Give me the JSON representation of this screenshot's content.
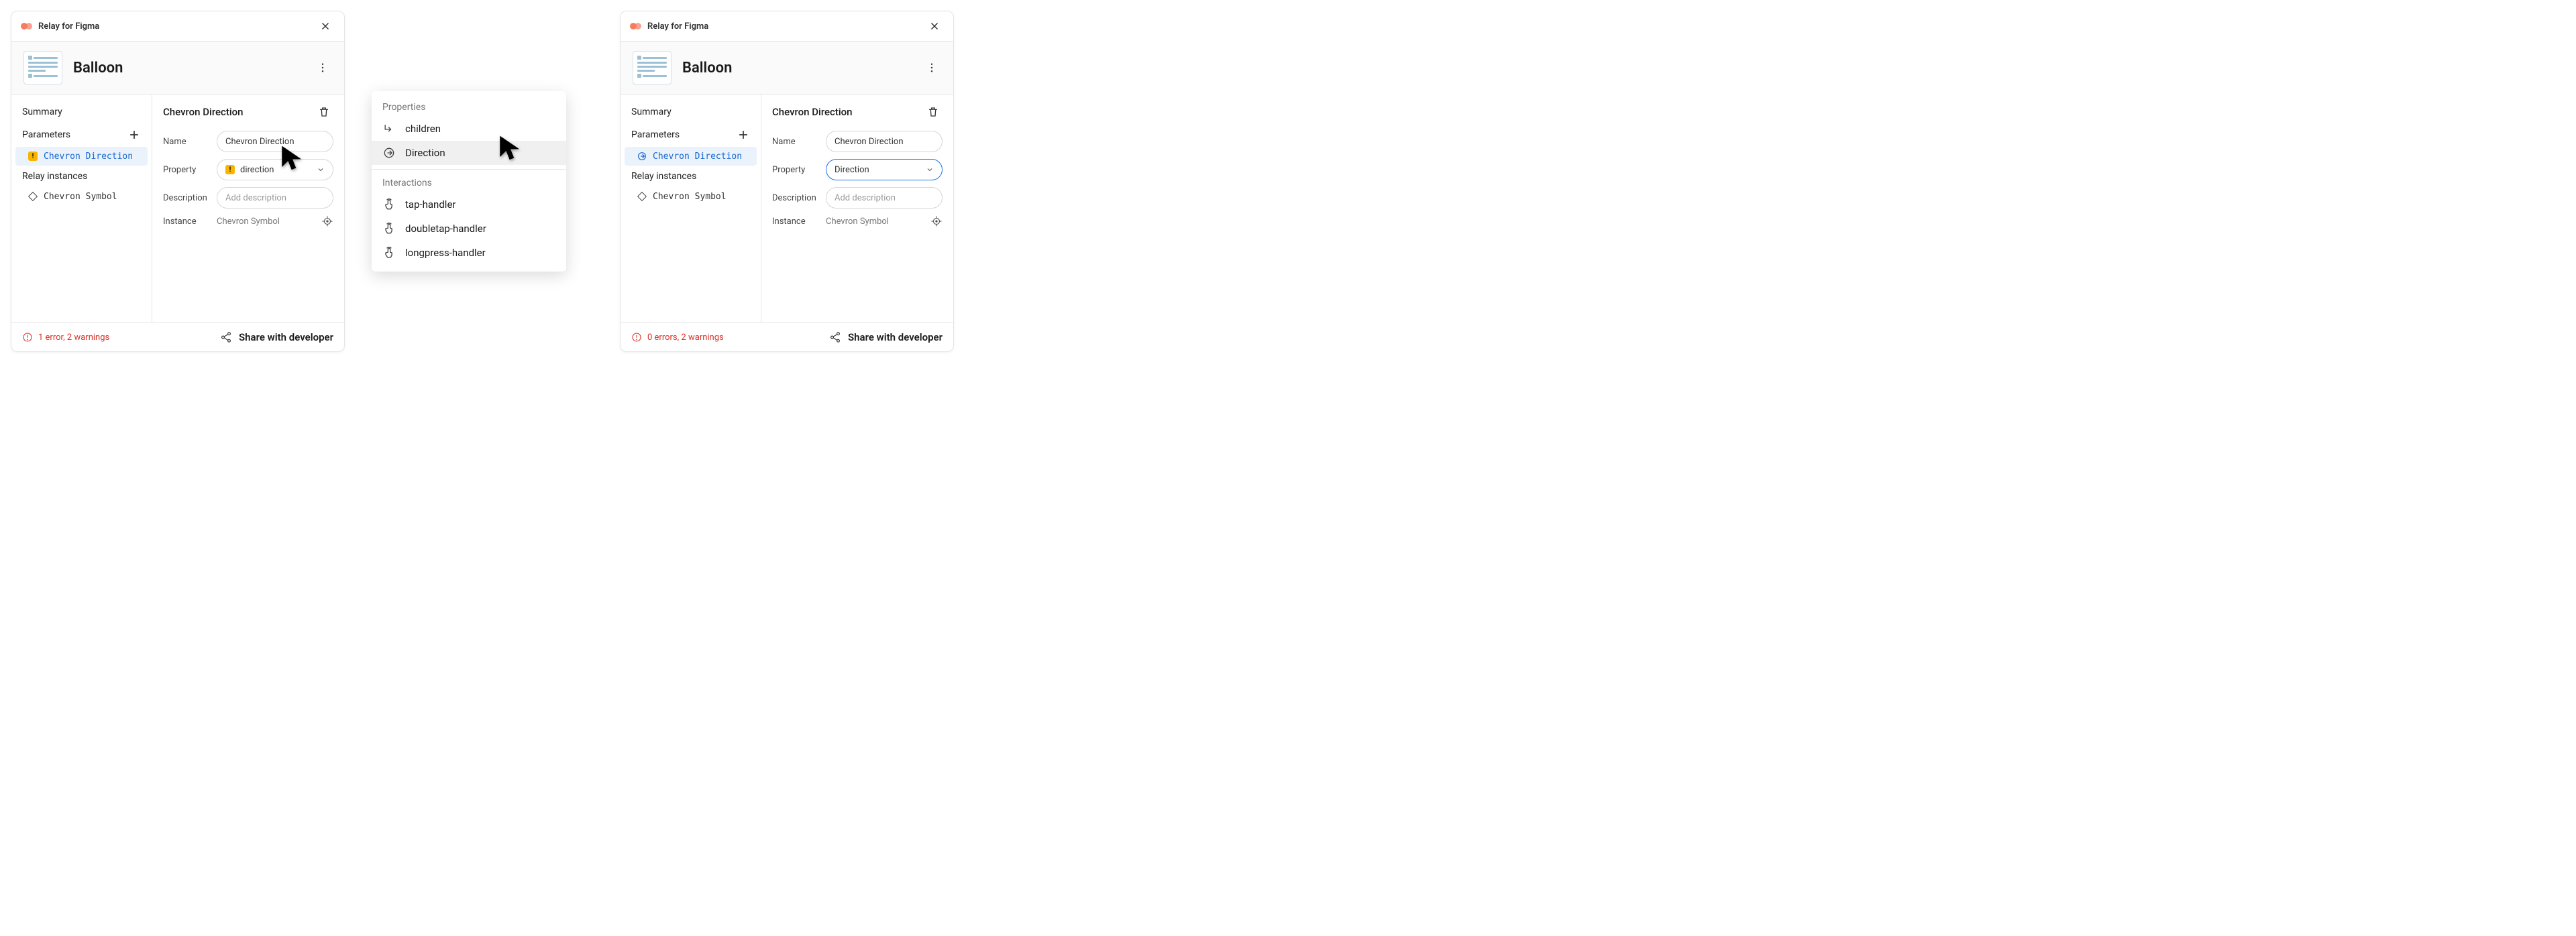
{
  "app_title": "Relay for Figma",
  "component_name": "Balloon",
  "sidebar": {
    "summary": "Summary",
    "parameters": "Parameters",
    "param_item_warn": "Chevron Direction",
    "param_item_ok": "Chevron Direction",
    "instances": "Relay instances",
    "instance_item": "Chevron Symbol"
  },
  "detail": {
    "title": "Chevron Direction",
    "labels": {
      "name": "Name",
      "property": "Property",
      "description": "Description",
      "instance": "Instance"
    },
    "name_value": "Chevron Direction",
    "property_value_warn": "direction",
    "property_value_ok": "Direction",
    "description_placeholder": "Add description",
    "instance_value": "Chevron Symbol"
  },
  "popover": {
    "properties_heading": "Properties",
    "interactions_heading": "Interactions",
    "children": "children",
    "direction": "Direction",
    "tap": "tap-handler",
    "doubletap": "doubletap-handler",
    "longpress": "longpress-handler"
  },
  "footer": {
    "status_left": "1 error, 2 warnings",
    "status_right": "0 errors, 2 warnings",
    "share": "Share with developer"
  }
}
